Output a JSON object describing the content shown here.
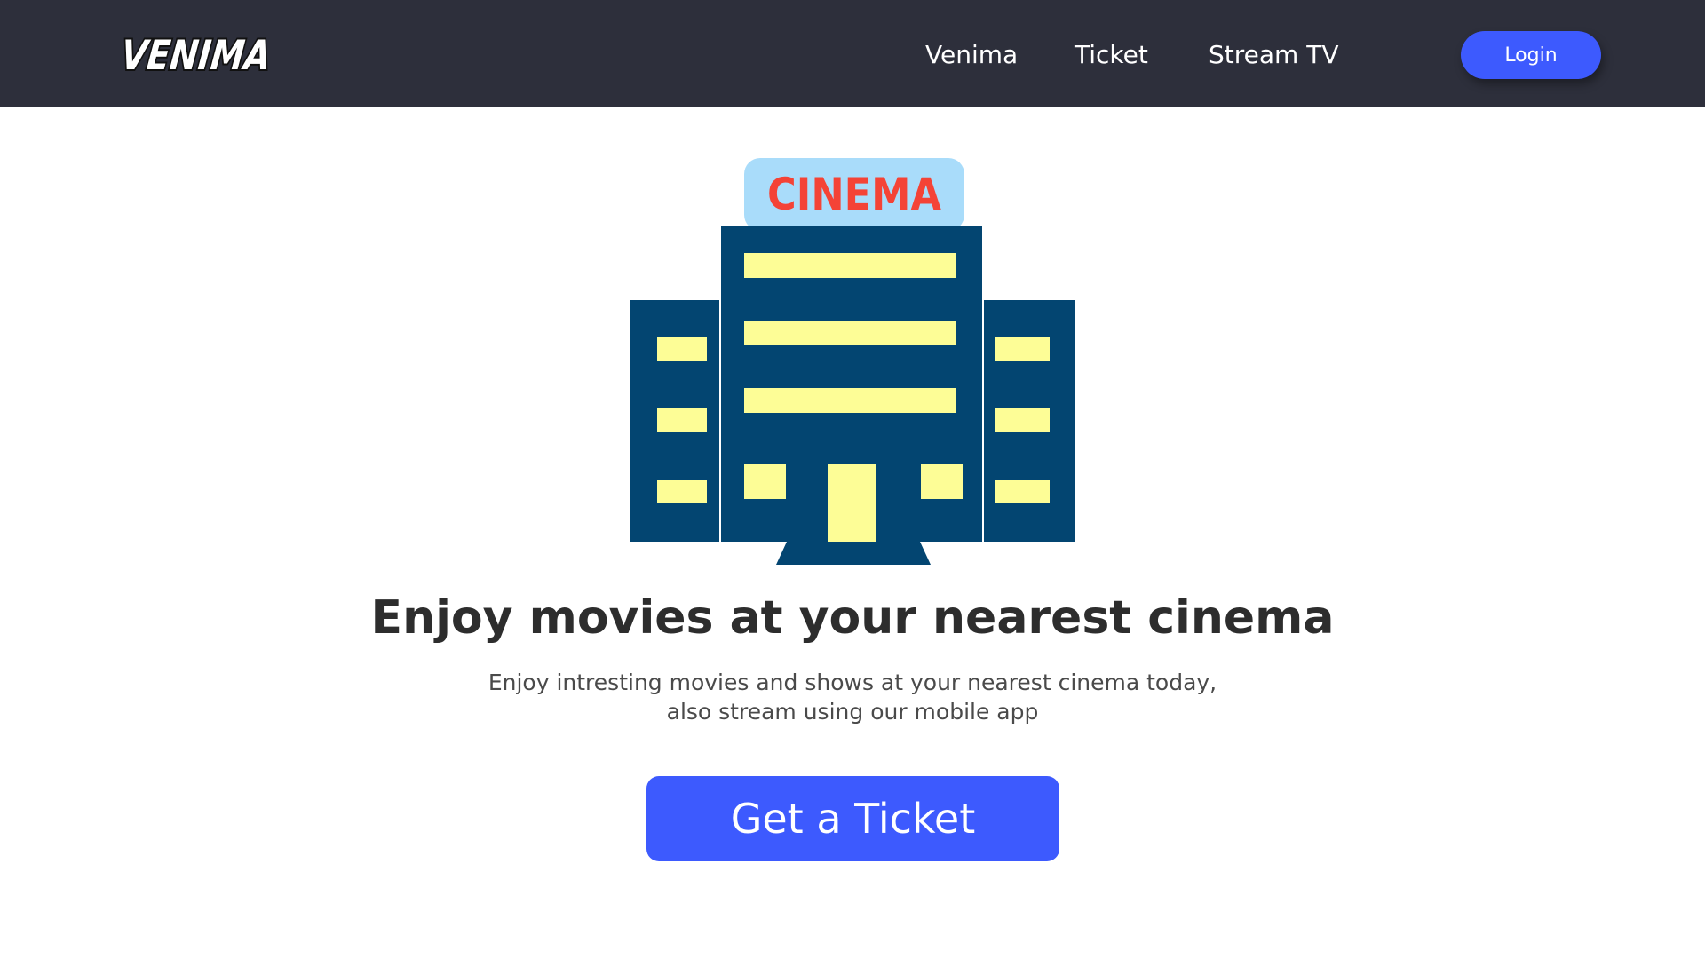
{
  "navbar": {
    "logo_text": "VENIMA",
    "links": [
      {
        "label": "Venima"
      },
      {
        "label": "Ticket"
      },
      {
        "label": "Stream TV"
      }
    ],
    "login_label": "Login"
  },
  "hero": {
    "sign_text": "CINEMA",
    "headline": "Enjoy movies at your nearest cinema",
    "subtext_line1": "Enjoy intresting movies and shows at your nearest cinema today,",
    "subtext_line2": "also stream using our mobile app",
    "cta_label": "Get a Ticket"
  },
  "colors": {
    "navbar_bg": "#2d2f3b",
    "accent": "#3d5afe",
    "building": "#034571",
    "window": "#fdfd96",
    "sign_bg": "#a9dcfa",
    "sign_text": "#f44336"
  },
  "icons": {
    "logo": "venima-logo",
    "illustration": "cinema-building-icon"
  }
}
